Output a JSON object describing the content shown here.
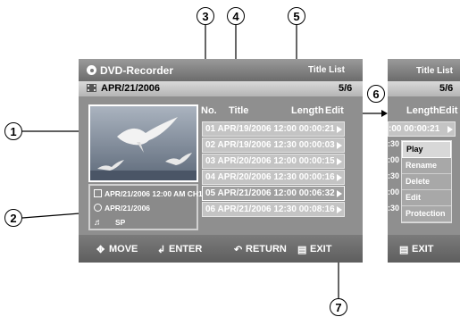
{
  "header": {
    "app": "DVD-Recorder",
    "section": "Title List",
    "date": "APR/21/2006",
    "page": "5/6"
  },
  "columns": {
    "no": "No.",
    "title": "Title",
    "length": "Length",
    "edit": "Edit"
  },
  "rows": [
    {
      "text": "01 APR/19/2006  12:00  00:00:21"
    },
    {
      "text": "02 APR/19/2006  12:30  00:00:03"
    },
    {
      "text": "03 APR/20/2006  12:00  00:00:15"
    },
    {
      "text": "04 APR/20/2006  12:30  00:00:16"
    },
    {
      "text": "05 APR/21/2006  12:00  00:06:32"
    },
    {
      "text": "06 APR/21/2006  12:30  00:08:16"
    }
  ],
  "info": {
    "line1": "APR/21/2006 12:00 AM CH1",
    "line2": "APR/21/2006",
    "line3": "SP"
  },
  "bottom": {
    "move": "MOVE",
    "enter": "ENTER",
    "return": "RETURN",
    "exit": "EXIT"
  },
  "side": {
    "section": "Title List",
    "page": "5/6",
    "length_edit": "LengthEdit",
    "row_text": ":00  00:00:21",
    "exit": "EXIT",
    "partials": [
      ":30",
      ":00",
      ":30",
      ":00",
      ":30"
    ]
  },
  "menu": [
    "Play",
    "Rename",
    "Delete",
    "Edit",
    "Protection"
  ],
  "callouts": {
    "c1": "1",
    "c2": "2",
    "c3": "3",
    "c4": "4",
    "c5": "5",
    "c6": "6",
    "c7": "7"
  }
}
